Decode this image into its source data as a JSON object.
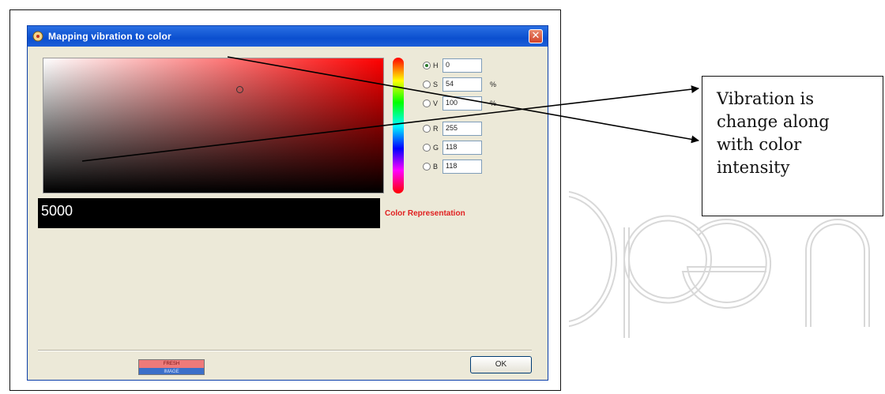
{
  "window": {
    "title": "Mapping vibration to color",
    "title_icon": "app-icon",
    "close_icon": "close-icon",
    "close_symbol": "✕"
  },
  "picker": {
    "base_color": "#ff0000",
    "selected_color": "#ff7676"
  },
  "fields": [
    {
      "name": "H",
      "value": "0",
      "unit": "",
      "checked": true
    },
    {
      "name": "S",
      "value": "54",
      "unit": "%",
      "checked": false
    },
    {
      "name": "V",
      "value": "100",
      "unit": "%",
      "checked": false
    },
    {
      "name": "R",
      "value": "255",
      "unit": "",
      "checked": false
    },
    {
      "name": "G",
      "value": "118",
      "unit": "",
      "checked": false
    },
    {
      "name": "B",
      "value": "118",
      "unit": "",
      "checked": false
    }
  ],
  "value_display": "5000",
  "color_representation_label": "Color Representation",
  "swatch": {
    "top": "FRESH",
    "bottom": "IMAGE"
  },
  "ok_label": "OK",
  "annotation": "Vibration is change along with color intensity",
  "watermark_text": "Open"
}
